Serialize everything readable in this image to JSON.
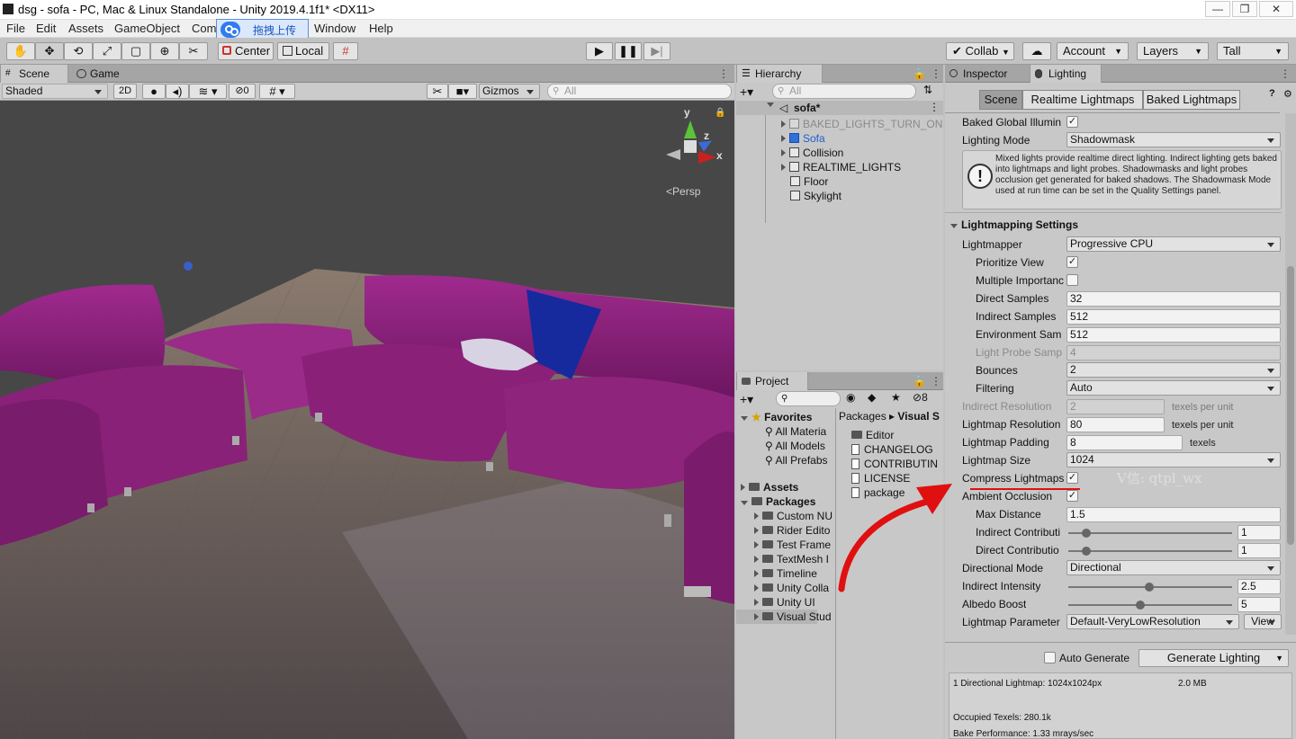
{
  "window": {
    "title": "dsg - sofa - PC, Mac & Linux Standalone - Unity 2019.4.1f1* <DX11>",
    "minimize": "—",
    "maximize": "❐",
    "close": "✕"
  },
  "menu": [
    "File",
    "Edit",
    "Assets",
    "GameObject",
    "Com",
    "Window",
    "Help"
  ],
  "overlay": {
    "label": "拖拽上传"
  },
  "toolbar": {
    "center_label": "Center",
    "local_label": "Local",
    "collab_label": "Collab",
    "account_label": "Account",
    "layers_label": "Layers",
    "layout_label": "Tall"
  },
  "scene": {
    "tabs": [
      "Scene",
      "Game"
    ],
    "shading": "Shaded",
    "mode2d": "2D",
    "hidden_count": "0",
    "gizmos": "Gizmos",
    "search_placeholder": "All",
    "persp": "Persp",
    "axis": {
      "y": "y",
      "z": "z",
      "x": "x"
    }
  },
  "hierarchy": {
    "tab": "Hierarchy",
    "search_placeholder": "All",
    "root": "sofa*",
    "items": [
      {
        "label": "BAKED_LIGHTS_TURN_ON",
        "dim": true,
        "expand": true
      },
      {
        "label": "Sofa",
        "blue": true,
        "expand": true
      },
      {
        "label": "Collision",
        "expand": true
      },
      {
        "label": "REALTIME_LIGHTS",
        "expand": true
      },
      {
        "label": "Floor",
        "expand": false
      },
      {
        "label": "Skylight",
        "expand": false
      }
    ]
  },
  "project": {
    "tab": "Project",
    "count": "8",
    "favorites_label": "Favorites",
    "favorites": [
      "All Materia",
      "All Models",
      "All Prefabs"
    ],
    "assets_label": "Assets",
    "packages_label": "Packages",
    "packages": [
      "Custom NU",
      "Rider Edito",
      "Test Frame",
      "TextMesh I",
      "Timeline",
      "Unity Colla",
      "Unity UI",
      "Visual Stud"
    ],
    "breadcrumb": [
      "Packages",
      "Visual S"
    ],
    "files": [
      {
        "label": "Editor",
        "type": "folder"
      },
      {
        "label": "CHANGELOG",
        "type": "file"
      },
      {
        "label": "CONTRIBUTIN",
        "type": "file"
      },
      {
        "label": "LICENSE",
        "type": "file"
      },
      {
        "label": "package",
        "type": "file"
      }
    ]
  },
  "inspector": {
    "tabs": [
      "Inspector",
      "Lighting"
    ],
    "subtabs": [
      "Scene",
      "Realtime Lightmaps",
      "Baked Lightmaps"
    ],
    "baked_gi_label": "Baked Global Illumin",
    "lighting_mode_label": "Lighting Mode",
    "lighting_mode_value": "Shadowmask",
    "help_text": "Mixed lights provide realtime direct lighting. Indirect lighting gets baked into lightmaps and light probes. Shadowmasks and light probes occlusion get generated for baked shadows. The Shadowmask Mode used at run time can be set in the Quality Settings panel.",
    "section_label": "Lightmapping Settings",
    "lightmapper_label": "Lightmapper",
    "lightmapper_value": "Progressive CPU",
    "prioritize_label": "Prioritize View",
    "multiple_importance_label": "Multiple Importanc",
    "direct_samples_label": "Direct Samples",
    "direct_samples_value": "32",
    "indirect_samples_label": "Indirect Samples",
    "indirect_samples_value": "512",
    "env_samples_label": "Environment Sam",
    "env_samples_value": "512",
    "light_probe_label": "Light Probe Samp",
    "light_probe_value": "4",
    "bounces_label": "Bounces",
    "bounces_value": "2",
    "filtering_label": "Filtering",
    "filtering_value": "Auto",
    "indirect_res_label": "Indirect Resolution",
    "indirect_res_value": "2",
    "texels_per_unit": "texels per unit",
    "lightmap_res_label": "Lightmap Resolution",
    "lightmap_res_value": "80",
    "lightmap_padding_label": "Lightmap Padding",
    "lightmap_padding_value": "8",
    "texels": "texels",
    "lightmap_size_label": "Lightmap Size",
    "lightmap_size_value": "1024",
    "compress_label": "Compress Lightmaps",
    "ao_label": "Ambient Occlusion",
    "max_distance_label": "Max Distance",
    "max_distance_value": "1.5",
    "indirect_contrib_label": "Indirect Contributi",
    "indirect_contrib_value": "1",
    "direct_contrib_label": "Direct Contributio",
    "direct_contrib_value": "1",
    "directional_mode_label": "Directional Mode",
    "directional_mode_value": "Directional",
    "indirect_intensity_label": "Indirect Intensity",
    "indirect_intensity_value": "2.5",
    "albedo_boost_label": "Albedo Boost",
    "albedo_boost_value": "5",
    "lightmap_params_label": "Lightmap Parameter",
    "lightmap_params_value": "Default-VeryLowResolution",
    "view_button": "View",
    "auto_generate_label": "Auto Generate",
    "generate_button": "Generate Lighting",
    "stats_lightmap": "1 Directional Lightmap: 1024x1024px",
    "stats_size": "2.0 MB",
    "stats_texels": "Occupied Texels: 280.1k",
    "stats_bake": "Bake Performance: 1.33 mrays/sec",
    "watermark": "V信: qtpl_wx"
  },
  "colors": {
    "accent": "#2f6fde",
    "annotation": "#e01010",
    "sofa": "#8a1f7a"
  }
}
